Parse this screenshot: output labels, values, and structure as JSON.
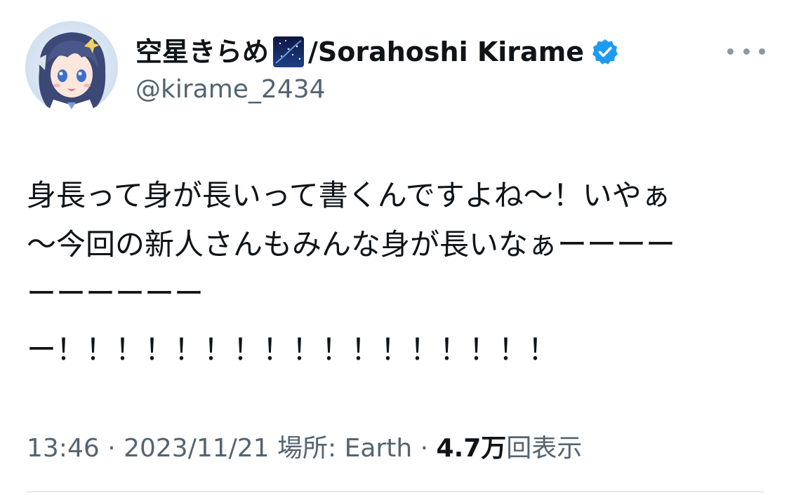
{
  "author": {
    "display_name": "空星きらめ",
    "name_suffix": "/Sorahoshi Kirame",
    "handle": "@kirame_2434",
    "name_emoji": "night-sky-emoji",
    "verified_icon": "verified-badge-icon",
    "verified_color": "#1d9bf0"
  },
  "tweet": {
    "lines": [
      "身長って身が長いって書くんですよね〜！いやぁ",
      "〜今回の新人さんもみんな身が長いなぁーーーー",
      "ーーーーーー",
      "ー！！！！！！！！！！！！！！！！！"
    ]
  },
  "meta": {
    "time": "13:46",
    "sep1": " · ",
    "date": "2023/11/21",
    "location_label": " 場所: ",
    "location": "Earth",
    "sep2": " · ",
    "views_count": "4.7万",
    "views_label": "回表示"
  },
  "colors": {
    "text": "#0f1419",
    "secondary": "#536471",
    "divider": "#cfd9de"
  },
  "icons": {
    "more": "more-dots-icon"
  }
}
